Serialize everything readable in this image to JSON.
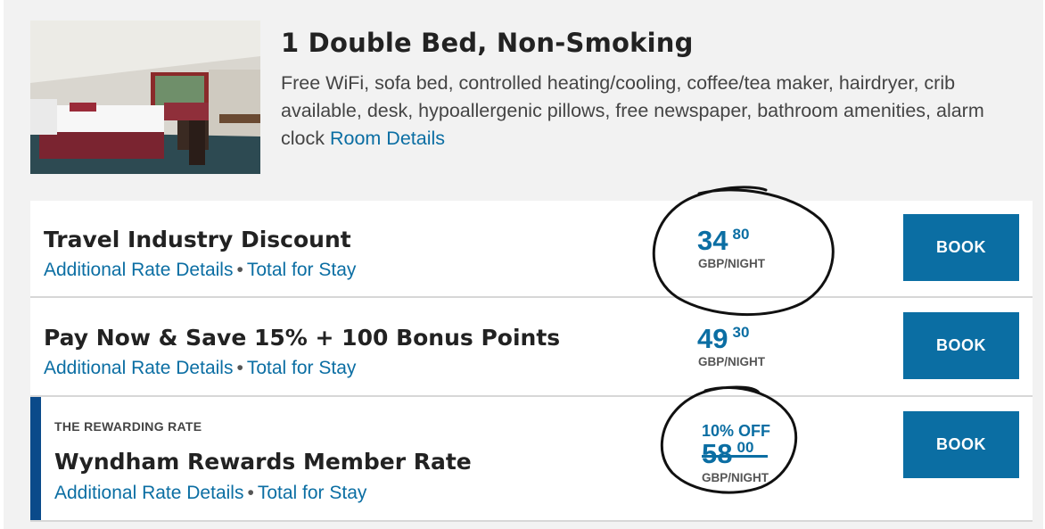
{
  "room": {
    "title": "1 Double Bed, Non-Smoking",
    "description": "Free WiFi, sofa bed, controlled heating/cooling, coffee/tea maker, hairdryer, crib available, desk, hypoallergenic pillows, free newspaper, bathroom amenities, alarm clock",
    "details_link": "Room Details"
  },
  "rates": [
    {
      "title": "Travel Industry Discount",
      "link_details": "Additional Rate Details",
      "separator": "•",
      "link_total": "Total for Stay",
      "price_whole": "34",
      "price_cents": "80",
      "per_night": "GBP/NIGHT",
      "book_label": "BOOK"
    },
    {
      "title": "Pay Now & Save 15% + 100 Bonus Points",
      "link_details": "Additional Rate Details",
      "separator": "•",
      "link_total": "Total for Stay",
      "price_whole": "49",
      "price_cents": "30",
      "per_night": "GBP/NIGHT",
      "book_label": "BOOK"
    },
    {
      "kicker": "THE REWARDING RATE",
      "title": "Wyndham Rewards Member Rate",
      "link_details": "Additional Rate Details",
      "separator": "•",
      "link_total": "Total for Stay",
      "discount": "10% OFF",
      "price_whole": "58",
      "price_cents": "00",
      "per_night": "GBP/NIGHT",
      "book_label": "BOOK"
    }
  ],
  "colors": {
    "accent": "#0b6ea3",
    "rewards_bar": "#0a4a8a"
  }
}
